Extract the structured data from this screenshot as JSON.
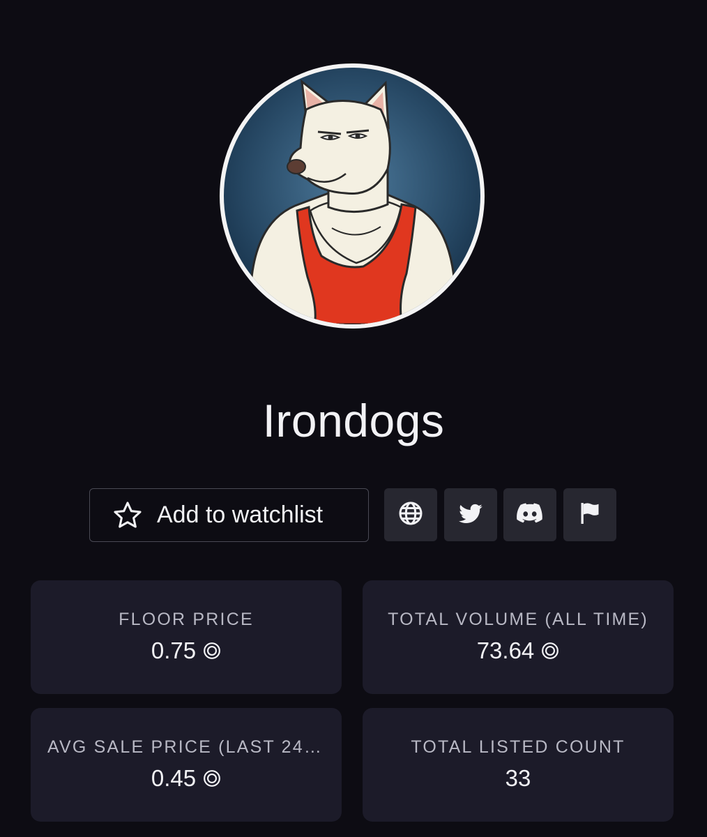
{
  "collection": {
    "name": "Irondogs",
    "avatar_alt": "irondog-avatar"
  },
  "actions": {
    "watchlist_label": "Add to watchlist",
    "watchlist_icon": "star-icon",
    "social_icons": [
      "globe-icon",
      "twitter-icon",
      "discord-icon",
      "flag-icon"
    ]
  },
  "stats": [
    {
      "label": "FLOOR PRICE",
      "value": "0.75",
      "currency_icon": "sol-icon"
    },
    {
      "label": "TOTAL VOLUME (ALL TIME)",
      "value": "73.64",
      "currency_icon": "sol-icon"
    },
    {
      "label": "AVG SALE PRICE (LAST 24H)",
      "value": "0.45",
      "currency_icon": "sol-icon"
    },
    {
      "label": "TOTAL LISTED COUNT",
      "value": "33",
      "currency_icon": ""
    }
  ],
  "colors": {
    "background": "#0d0c13",
    "card": "#1c1b29",
    "social_button": "#272730",
    "text": "#f2f2f5",
    "muted": "#b8b8c4"
  }
}
